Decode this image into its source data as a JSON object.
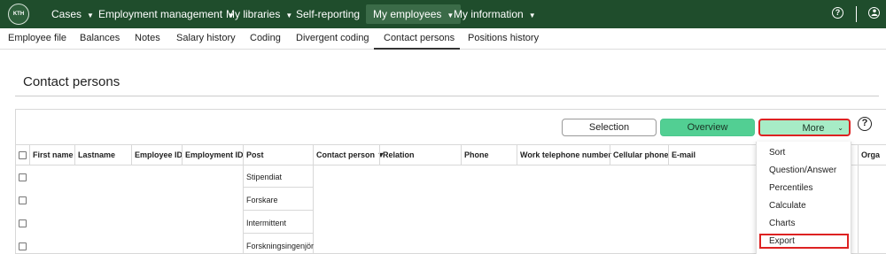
{
  "topnav": {
    "logo_text": "KTH",
    "items": [
      {
        "label": "Cases"
      },
      {
        "label": "Employment management"
      },
      {
        "label": "My libraries"
      },
      {
        "label": "Self-reporting"
      },
      {
        "label": "My employees"
      },
      {
        "label": "My information"
      }
    ],
    "active_item": "My employees",
    "help_icon": "question-circle-icon",
    "user_icon": "user-circle-icon",
    "colors": {
      "background": "#1f4d2c",
      "active": "#3b6b48"
    }
  },
  "subtabs": [
    {
      "label": "Employee file"
    },
    {
      "label": "Balances"
    },
    {
      "label": "Notes"
    },
    {
      "label": "Salary history"
    },
    {
      "label": "Coding"
    },
    {
      "label": "Divergent coding"
    },
    {
      "label": "Contact persons"
    },
    {
      "label": "Positions history"
    }
  ],
  "active_subtab": "Contact persons",
  "page": {
    "title": "Contact persons"
  },
  "toolbar": {
    "selection_label": "Selection",
    "overview_label": "Overview",
    "more_label": "More",
    "help_icon": "question-circle-icon",
    "colors": {
      "overview": "#52cf93",
      "more": "#a7ecc6",
      "highlight": "#dd2222"
    }
  },
  "table": {
    "columns": [
      "First name",
      "Lastname",
      "Employee ID",
      "Employment ID",
      "Post",
      "Contact person",
      "Relation",
      "Phone",
      "Work telephone number",
      "Cellular phone",
      "E-mail",
      "Orga"
    ],
    "sort_indicator": "▼",
    "rows": [
      {
        "post": "Stipendiat"
      },
      {
        "post": "Forskare"
      },
      {
        "post": "Intermittent"
      },
      {
        "post": "Forskningsingenjör"
      }
    ]
  },
  "more_menu": {
    "items": [
      {
        "label": "Sort"
      },
      {
        "label": "Question/Answer"
      },
      {
        "label": "Percentiles"
      },
      {
        "label": "Calculate"
      },
      {
        "label": "Charts"
      },
      {
        "label": "Export"
      }
    ],
    "highlighted_item": "Export"
  }
}
